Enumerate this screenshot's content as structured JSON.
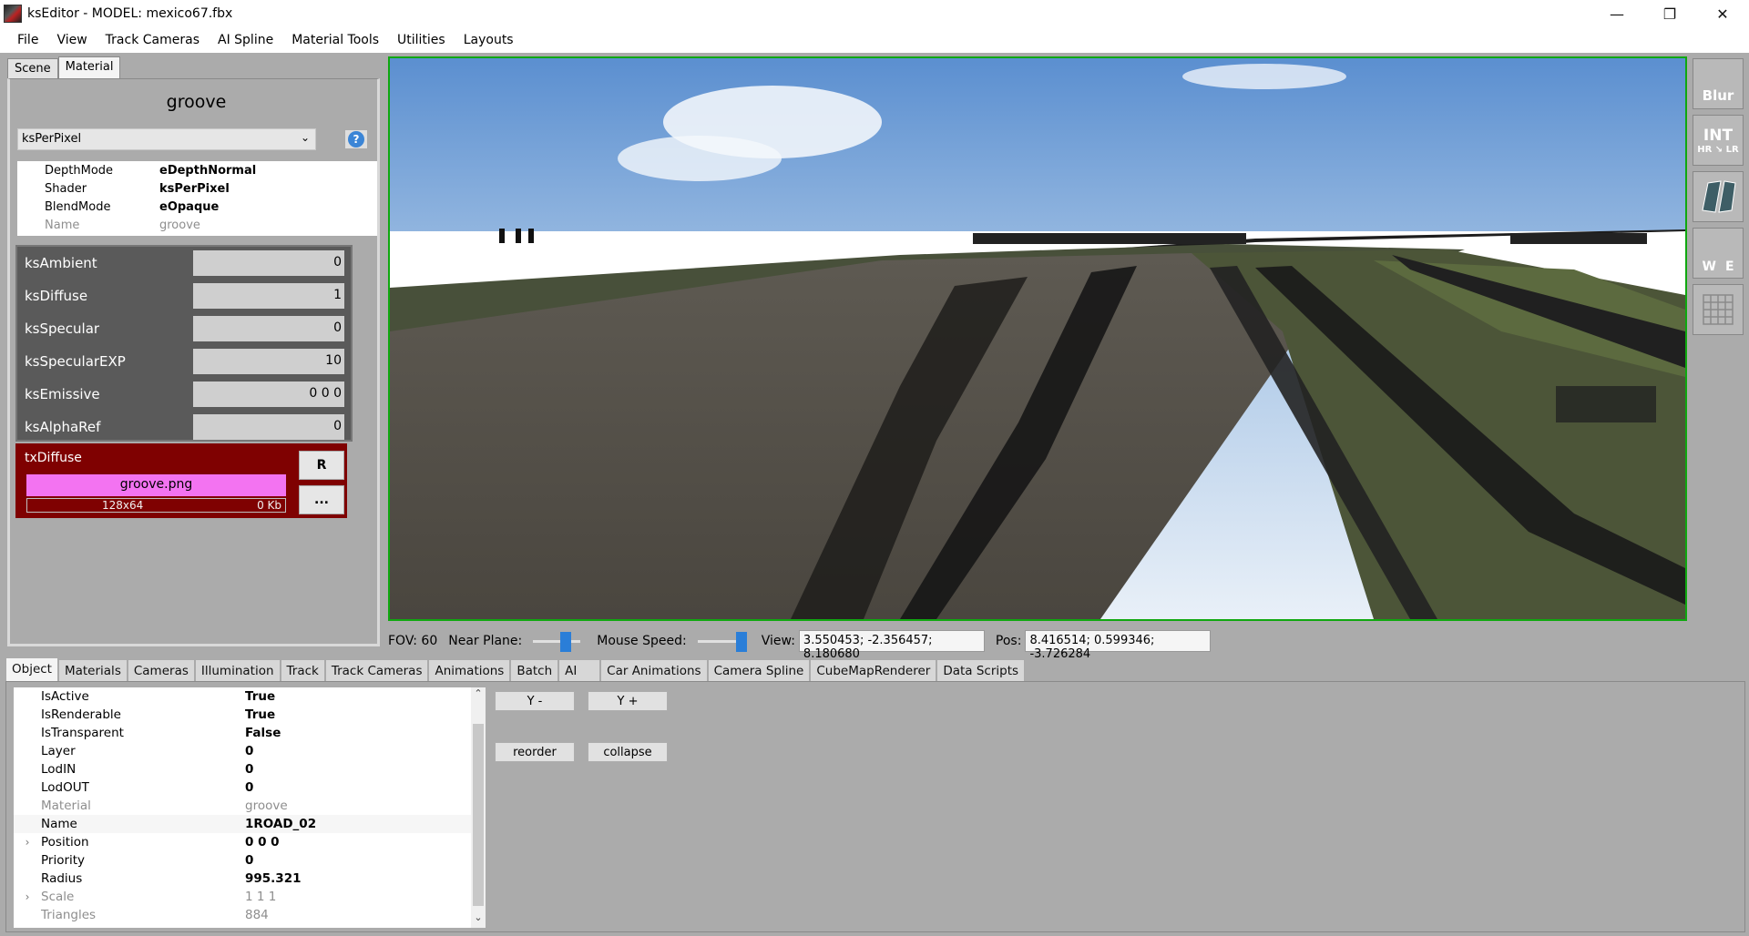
{
  "window": {
    "title": "ksEditor - MODEL: mexico67.fbx",
    "minimize": "—",
    "restore": "❐",
    "close": "✕"
  },
  "menu": [
    "File",
    "View",
    "Track Cameras",
    "AI Spline",
    "Material Tools",
    "Utilities",
    "Layouts"
  ],
  "left_tabs": [
    "Scene",
    "Material"
  ],
  "material": {
    "name": "groove",
    "shader_select": "ksPerPixel",
    "props": [
      {
        "key": "DepthMode",
        "value": "eDepthNormal"
      },
      {
        "key": "Shader",
        "value": "ksPerPixel"
      },
      {
        "key": "BlendMode",
        "value": "eOpaque"
      },
      {
        "key": "Name",
        "value": "groove"
      }
    ],
    "params": [
      {
        "label": "ksAmbient",
        "value": "0"
      },
      {
        "label": "ksDiffuse",
        "value": "1"
      },
      {
        "label": "ksSpecular",
        "value": "0"
      },
      {
        "label": "ksSpecularEXP",
        "value": "10"
      },
      {
        "label": "ksEmissive",
        "value": "0 0 0"
      },
      {
        "label": "ksAlphaRef",
        "value": "0"
      }
    ],
    "texture": {
      "slot": "txDiffuse",
      "file": "groove.png",
      "dims": "128x64",
      "size": "0 Kb",
      "reload_label": "R",
      "browse_label": "..."
    }
  },
  "tools": {
    "blur": "Blur",
    "int": "INT",
    "hr": "HR",
    "lr": "LR",
    "w": "W",
    "e": "E"
  },
  "status": {
    "fov": "FOV: 60",
    "near_plane_label": "Near Plane:",
    "mouse_speed_label": "Mouse Speed:",
    "view_label": "View:",
    "view_value": "3.550453; -2.356457; 8.180680",
    "pos_label": "Pos:",
    "pos_value": "8.416514; 0.599346; -3.726284"
  },
  "bottom_tabs": [
    "Object",
    "Materials",
    "Cameras",
    "Illumination",
    "Track",
    "Track Cameras",
    "Animations",
    "Batch",
    "AI",
    "Car Animations",
    "Camera Spline",
    "CubeMapRenderer",
    "Data Scripts"
  ],
  "object_props": [
    {
      "key": "IsActive",
      "value": "True"
    },
    {
      "key": "IsRenderable",
      "value": "True"
    },
    {
      "key": "IsTransparent",
      "value": "False"
    },
    {
      "key": "Layer",
      "value": "0"
    },
    {
      "key": "LodIN",
      "value": "0"
    },
    {
      "key": "LodOUT",
      "value": "0"
    },
    {
      "key": "Material",
      "value": "groove"
    },
    {
      "key": "Name",
      "value": "1ROAD_02"
    },
    {
      "key": "Position",
      "value": "0 0 0"
    },
    {
      "key": "Priority",
      "value": "0"
    },
    {
      "key": "Radius",
      "value": "995.321"
    },
    {
      "key": "Scale",
      "value": "1 1 1"
    },
    {
      "key": "Triangles",
      "value": "884"
    }
  ],
  "buttons": {
    "y_minus": "Y -",
    "y_plus": "Y +",
    "reorder": "reorder",
    "collapse": "collapse"
  }
}
